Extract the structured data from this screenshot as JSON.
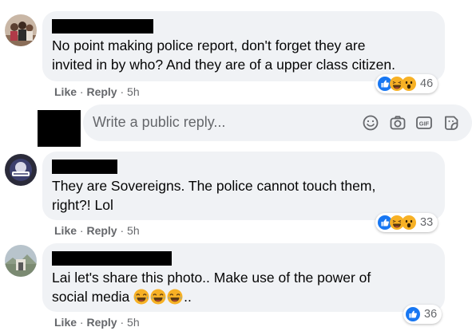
{
  "comments": [
    {
      "text_line1": "No point making police report, don't forget they are",
      "text_line2": "invited in by who? And they are of a upper class citizen.",
      "reaction_icons": [
        "like-icon",
        "haha-icon",
        "wow-icon"
      ],
      "reaction_count": "46",
      "actions": {
        "like": "Like",
        "sep1": "·",
        "reply": "Reply",
        "sep2": "·",
        "time": "5h"
      }
    },
    {
      "text_line1": "They are Sovereigns. The police cannot touch them,",
      "text_line2": "right?! Lol",
      "reaction_icons": [
        "like-icon",
        "haha-icon",
        "wow-icon"
      ],
      "reaction_count": "33",
      "actions": {
        "like": "Like",
        "sep1": "·",
        "reply": "Reply",
        "sep2": "·",
        "time": "5h"
      }
    },
    {
      "text_line1": "Lai let's share this photo.. Make use of the power of",
      "text_line2": "social media",
      "text_line2_suffix": "..",
      "inline_emoji": [
        "laughing-emoji",
        "laughing-emoji",
        "laughing-emoji"
      ],
      "reaction_icons": [
        "like-icon"
      ],
      "reaction_count": "36",
      "actions": {
        "like": "Like",
        "sep1": "·",
        "reply": "Reply",
        "sep2": "·",
        "time": "5h"
      }
    }
  ],
  "reply_box": {
    "placeholder": "Write a public reply...",
    "icons": [
      "emoji-icon",
      "camera-icon",
      "gif-icon",
      "sticker-icon"
    ]
  },
  "colors": {
    "bubble_bg": "#f0f2f5",
    "secondary_text": "#65676b",
    "like_blue": "#1877f2",
    "reaction_yellow": "#f7b125"
  }
}
